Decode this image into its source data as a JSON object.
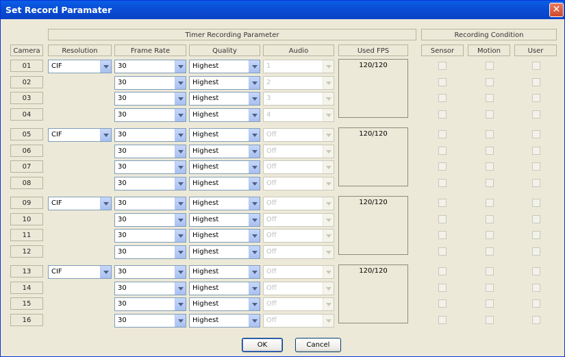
{
  "window": {
    "title": "Set Record Paramater",
    "close_glyph": "✕"
  },
  "headers": {
    "timer_group": "Timer Recording Parameter",
    "condition_group": "Recording Condition",
    "camera": "Camera",
    "resolution": "Resolution",
    "frame_rate": "Frame Rate",
    "quality": "Quality",
    "audio": "Audio",
    "used_fps": "Used FPS",
    "sensor": "Sensor",
    "motion": "Motion",
    "user": "User"
  },
  "groups": [
    {
      "resolution": "CIF",
      "used_fps": "120/120",
      "cameras": [
        {
          "id": "01",
          "frame_rate": "30",
          "quality": "Highest",
          "audio": "1"
        },
        {
          "id": "02",
          "frame_rate": "30",
          "quality": "Highest",
          "audio": "2"
        },
        {
          "id": "03",
          "frame_rate": "30",
          "quality": "Highest",
          "audio": "3"
        },
        {
          "id": "04",
          "frame_rate": "30",
          "quality": "Highest",
          "audio": "4"
        }
      ]
    },
    {
      "resolution": "CIF",
      "used_fps": "120/120",
      "cameras": [
        {
          "id": "05",
          "frame_rate": "30",
          "quality": "Highest",
          "audio": "Off"
        },
        {
          "id": "06",
          "frame_rate": "30",
          "quality": "Highest",
          "audio": "Off"
        },
        {
          "id": "07",
          "frame_rate": "30",
          "quality": "Highest",
          "audio": "Off"
        },
        {
          "id": "08",
          "frame_rate": "30",
          "quality": "Highest",
          "audio": "Off"
        }
      ]
    },
    {
      "resolution": "CIF",
      "used_fps": "120/120",
      "cameras": [
        {
          "id": "09",
          "frame_rate": "30",
          "quality": "Highest",
          "audio": "Off"
        },
        {
          "id": "10",
          "frame_rate": "30",
          "quality": "Highest",
          "audio": "Off"
        },
        {
          "id": "11",
          "frame_rate": "30",
          "quality": "Highest",
          "audio": "Off"
        },
        {
          "id": "12",
          "frame_rate": "30",
          "quality": "Highest",
          "audio": "Off"
        }
      ]
    },
    {
      "resolution": "CIF",
      "used_fps": "120/120",
      "cameras": [
        {
          "id": "13",
          "frame_rate": "30",
          "quality": "Highest",
          "audio": "Off"
        },
        {
          "id": "14",
          "frame_rate": "30",
          "quality": "Highest",
          "audio": "Off"
        },
        {
          "id": "15",
          "frame_rate": "30",
          "quality": "Highest",
          "audio": "Off"
        },
        {
          "id": "16",
          "frame_rate": "30",
          "quality": "Highest",
          "audio": "Off"
        }
      ]
    }
  ],
  "buttons": {
    "ok": "OK",
    "cancel": "Cancel"
  },
  "colors": {
    "title_bar": "#0a4fd6",
    "dialog_bg": "#ece9d8",
    "close_button": "#d04a2b"
  }
}
